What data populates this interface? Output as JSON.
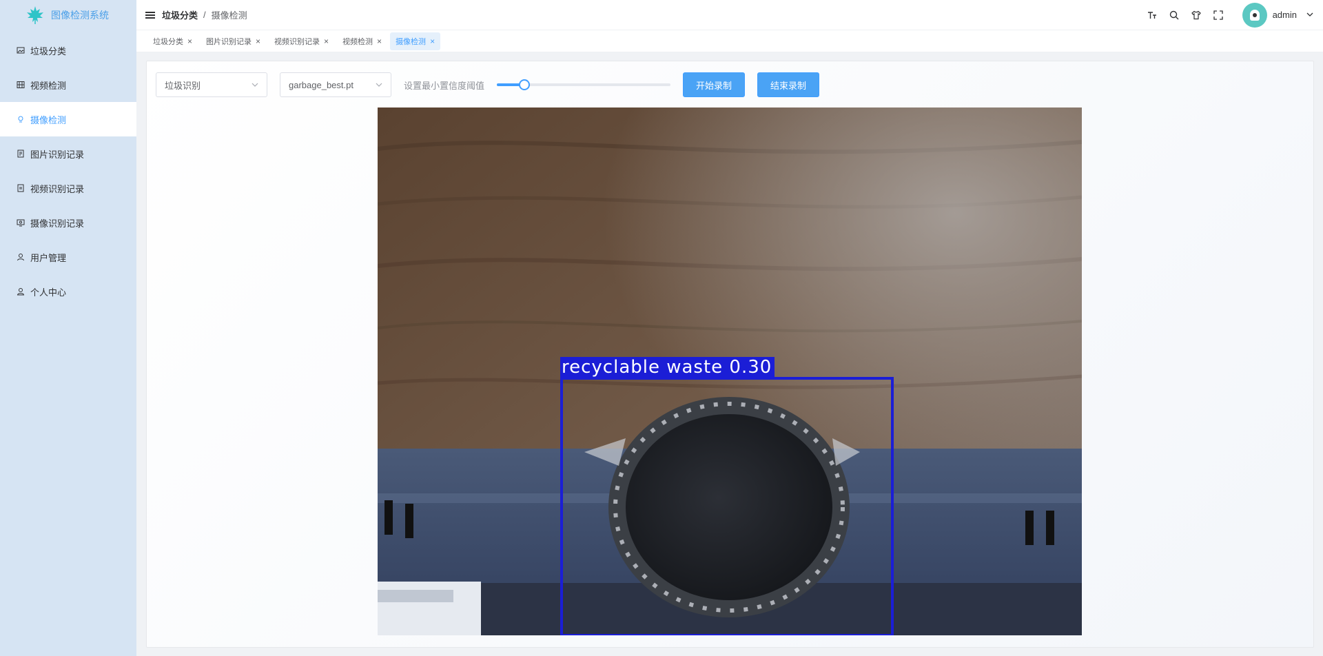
{
  "app": {
    "title": "图像检测系统"
  },
  "sidebar": {
    "items": [
      {
        "label": "垃圾分类",
        "icon": "image-icon",
        "active": false
      },
      {
        "label": "视频检测",
        "icon": "film-icon",
        "active": false
      },
      {
        "label": "摄像检测",
        "icon": "camera-icon",
        "active": true
      },
      {
        "label": "图片识别记录",
        "icon": "document-icon",
        "active": false
      },
      {
        "label": "视频识别记录",
        "icon": "document-icon",
        "active": false
      },
      {
        "label": "摄像识别记录",
        "icon": "monitor-icon",
        "active": false
      },
      {
        "label": "用户管理",
        "icon": "user-icon",
        "active": false
      },
      {
        "label": "个人中心",
        "icon": "user-icon",
        "active": false
      }
    ]
  },
  "header": {
    "breadcrumb": [
      "垃圾分类",
      "摄像检测"
    ],
    "separator": "/",
    "username": "admin"
  },
  "tabs": [
    {
      "label": "垃圾分类",
      "active": false
    },
    {
      "label": "图片识别记录",
      "active": false
    },
    {
      "label": "视频识别记录",
      "active": false
    },
    {
      "label": "视频检测",
      "active": false
    },
    {
      "label": "摄像检测",
      "active": true
    }
  ],
  "toolbar": {
    "task_select": "垃圾识别",
    "model_select": "garbage_best.pt",
    "threshold_label": "设置最小置信度阈值",
    "threshold_value": 0.16,
    "start_label": "开始录制",
    "stop_label": "结束录制"
  },
  "detection": {
    "label": "recyclable waste 0.30",
    "box_color": "#1b1ed6"
  },
  "colors": {
    "accent": "#409eff",
    "sidebar_bg": "#d6e4f3",
    "button_bg": "#4aa3f5"
  }
}
